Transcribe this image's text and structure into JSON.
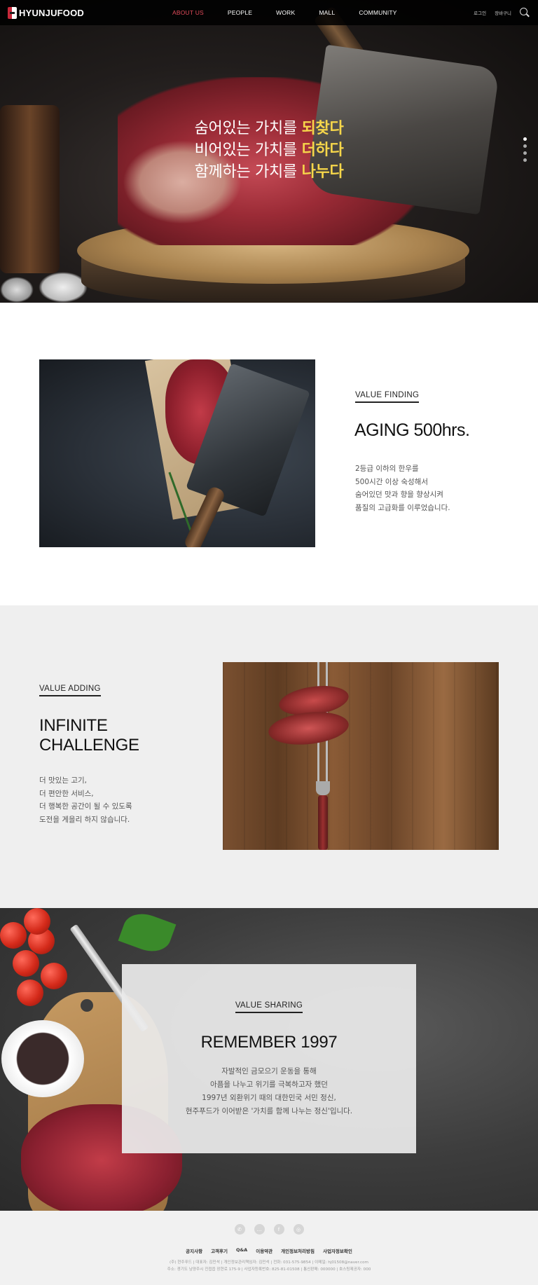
{
  "header": {
    "logo_text": "HYUNJUFOOD",
    "nav": [
      {
        "label": "ABOUT US",
        "active": true
      },
      {
        "label": "PEOPLE",
        "active": false
      },
      {
        "label": "WORK",
        "active": false
      },
      {
        "label": "MALL",
        "active": false
      },
      {
        "label": "COMMUNITY",
        "active": false
      }
    ],
    "login": "로그인",
    "cart": "장바구니",
    "search_icon": "search-icon"
  },
  "hero": {
    "lines": [
      {
        "normal": "숨어있는 가치를 ",
        "highlight": "되찾다"
      },
      {
        "normal": "비어있는 가치를 ",
        "highlight": "더하다"
      },
      {
        "normal": "함께하는 가치를 ",
        "highlight": "나누다"
      }
    ],
    "highlight_color": "#f6d64a",
    "slide_count": 4,
    "active_slide": 1
  },
  "value_finding": {
    "tag": "VALUE FINDING",
    "title": "AGING 500hrs.",
    "body": "2등급 이하의 한우를\n500시간 이상 숙성해서\n숨어있던 맛과 향을 향상시켜\n품질의 고급화를 이루었습니다."
  },
  "value_adding": {
    "tag": "VALUE ADDING",
    "title": "INFINITE\nCHALLENGE",
    "body": "더 맛있는 고기,\n더 편안한 서비스,\n더 행복한 공간이 될 수 있도록\n도전을 게을리 하지 않습니다."
  },
  "value_sharing": {
    "tag": "VALUE SHARING",
    "title": "REMEMBER 1997",
    "body": "자발적인 금모으기 운동을 통해\n아픔을 나누고 위기를 극복하고자 했던\n1997년 외환위기 때의 대한민국 서민 정신,\n현주푸드가 이어받은 '가치를 함께 나누는 정신'입니다."
  },
  "footer": {
    "social_icons": [
      "phone-icon",
      "chat-icon",
      "facebook-icon",
      "instagram-icon"
    ],
    "social_glyphs": [
      "✆",
      "…",
      "f",
      "◎"
    ],
    "links": [
      "공지사항",
      "고객후기",
      "Q&A",
      "이용약관",
      "개인정보처리방침",
      "사업자정보확인"
    ],
    "info_line1": "(주) 현주푸드 | 대표자: 김민석 | 개인정보관리책임자: 김민석 | 전화: 031-575-9854 | 이메일: hj01508@naver.com",
    "info_line2": "주소: 경기도 남양주시 진접읍 장현로 175-9 | 사업자등록번호: 825-81-01508 | 통신판매: 000000 | 호스팅제공자: 000"
  },
  "colors": {
    "accent": "#e24b5a",
    "brand_red": "#c8283a",
    "section_gray": "#efefef"
  }
}
